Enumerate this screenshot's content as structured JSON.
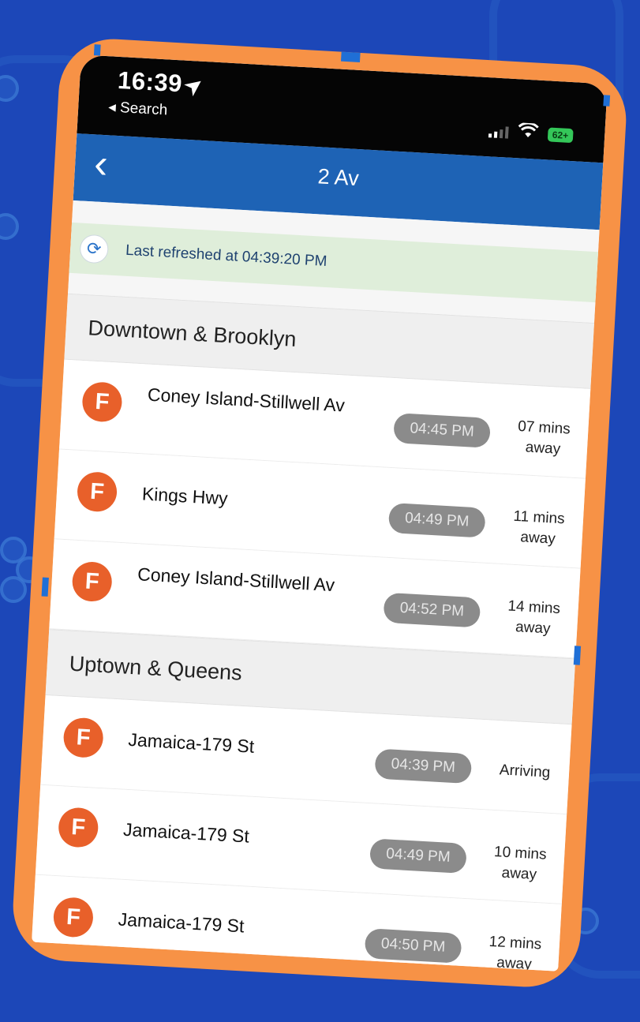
{
  "status_bar": {
    "time": "16:39",
    "back_to_app": "◂ Search",
    "battery": "62+"
  },
  "nav": {
    "back_glyph": "‹",
    "title": "2 Av"
  },
  "refresh": {
    "text": "Last refreshed at 04:39:20 PM",
    "icon": "refresh-icon"
  },
  "sections": [
    {
      "title": "Downtown & Brooklyn",
      "trains": [
        {
          "route": "F",
          "destination": "Coney Island-Stillwell Av",
          "arrival_time": "04:45 PM",
          "away": "07 mins away"
        },
        {
          "route": "F",
          "destination": "Kings Hwy",
          "arrival_time": "04:49 PM",
          "away": "11 mins away"
        },
        {
          "route": "F",
          "destination": "Coney Island-Stillwell Av",
          "arrival_time": "04:52 PM",
          "away": "14 mins away"
        }
      ]
    },
    {
      "title": "Uptown & Queens",
      "trains": [
        {
          "route": "F",
          "destination": "Jamaica-179 St",
          "arrival_time": "04:39 PM",
          "away": "Arriving"
        },
        {
          "route": "F",
          "destination": "Jamaica-179 St",
          "arrival_time": "04:49 PM",
          "away": "10 mins away"
        },
        {
          "route": "F",
          "destination": "Jamaica-179 St",
          "arrival_time": "04:50 PM",
          "away": "12 mins away"
        }
      ]
    }
  ],
  "colors": {
    "background": "#1c47b8",
    "frame": "#f79246",
    "nav_bar": "#1e63b5",
    "route_f": "#e8602a",
    "refresh_banner": "#dfeeda",
    "time_pill": "#8b8b8b"
  }
}
